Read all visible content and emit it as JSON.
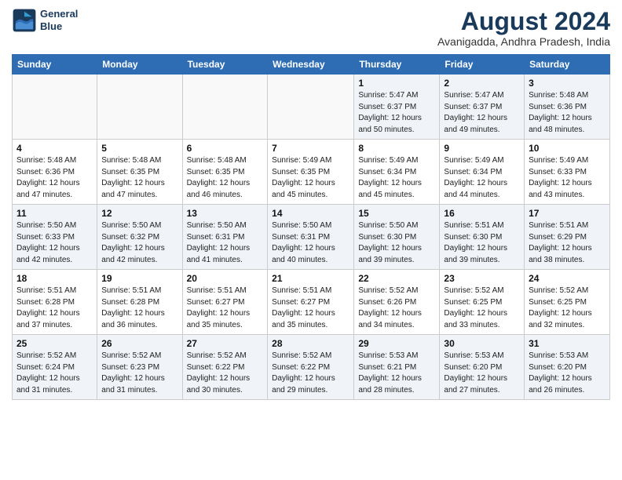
{
  "header": {
    "logo_line1": "General",
    "logo_line2": "Blue",
    "title": "August 2024",
    "subtitle": "Avanigadda, Andhra Pradesh, India"
  },
  "days_of_week": [
    "Sunday",
    "Monday",
    "Tuesday",
    "Wednesday",
    "Thursday",
    "Friday",
    "Saturday"
  ],
  "weeks": [
    [
      {
        "day": "",
        "info": ""
      },
      {
        "day": "",
        "info": ""
      },
      {
        "day": "",
        "info": ""
      },
      {
        "day": "",
        "info": ""
      },
      {
        "day": "1",
        "info": "Sunrise: 5:47 AM\nSunset: 6:37 PM\nDaylight: 12 hours\nand 50 minutes."
      },
      {
        "day": "2",
        "info": "Sunrise: 5:47 AM\nSunset: 6:37 PM\nDaylight: 12 hours\nand 49 minutes."
      },
      {
        "day": "3",
        "info": "Sunrise: 5:48 AM\nSunset: 6:36 PM\nDaylight: 12 hours\nand 48 minutes."
      }
    ],
    [
      {
        "day": "4",
        "info": "Sunrise: 5:48 AM\nSunset: 6:36 PM\nDaylight: 12 hours\nand 47 minutes."
      },
      {
        "day": "5",
        "info": "Sunrise: 5:48 AM\nSunset: 6:35 PM\nDaylight: 12 hours\nand 47 minutes."
      },
      {
        "day": "6",
        "info": "Sunrise: 5:48 AM\nSunset: 6:35 PM\nDaylight: 12 hours\nand 46 minutes."
      },
      {
        "day": "7",
        "info": "Sunrise: 5:49 AM\nSunset: 6:35 PM\nDaylight: 12 hours\nand 45 minutes."
      },
      {
        "day": "8",
        "info": "Sunrise: 5:49 AM\nSunset: 6:34 PM\nDaylight: 12 hours\nand 45 minutes."
      },
      {
        "day": "9",
        "info": "Sunrise: 5:49 AM\nSunset: 6:34 PM\nDaylight: 12 hours\nand 44 minutes."
      },
      {
        "day": "10",
        "info": "Sunrise: 5:49 AM\nSunset: 6:33 PM\nDaylight: 12 hours\nand 43 minutes."
      }
    ],
    [
      {
        "day": "11",
        "info": "Sunrise: 5:50 AM\nSunset: 6:33 PM\nDaylight: 12 hours\nand 42 minutes."
      },
      {
        "day": "12",
        "info": "Sunrise: 5:50 AM\nSunset: 6:32 PM\nDaylight: 12 hours\nand 42 minutes."
      },
      {
        "day": "13",
        "info": "Sunrise: 5:50 AM\nSunset: 6:31 PM\nDaylight: 12 hours\nand 41 minutes."
      },
      {
        "day": "14",
        "info": "Sunrise: 5:50 AM\nSunset: 6:31 PM\nDaylight: 12 hours\nand 40 minutes."
      },
      {
        "day": "15",
        "info": "Sunrise: 5:50 AM\nSunset: 6:30 PM\nDaylight: 12 hours\nand 39 minutes."
      },
      {
        "day": "16",
        "info": "Sunrise: 5:51 AM\nSunset: 6:30 PM\nDaylight: 12 hours\nand 39 minutes."
      },
      {
        "day": "17",
        "info": "Sunrise: 5:51 AM\nSunset: 6:29 PM\nDaylight: 12 hours\nand 38 minutes."
      }
    ],
    [
      {
        "day": "18",
        "info": "Sunrise: 5:51 AM\nSunset: 6:28 PM\nDaylight: 12 hours\nand 37 minutes."
      },
      {
        "day": "19",
        "info": "Sunrise: 5:51 AM\nSunset: 6:28 PM\nDaylight: 12 hours\nand 36 minutes."
      },
      {
        "day": "20",
        "info": "Sunrise: 5:51 AM\nSunset: 6:27 PM\nDaylight: 12 hours\nand 35 minutes."
      },
      {
        "day": "21",
        "info": "Sunrise: 5:51 AM\nSunset: 6:27 PM\nDaylight: 12 hours\nand 35 minutes."
      },
      {
        "day": "22",
        "info": "Sunrise: 5:52 AM\nSunset: 6:26 PM\nDaylight: 12 hours\nand 34 minutes."
      },
      {
        "day": "23",
        "info": "Sunrise: 5:52 AM\nSunset: 6:25 PM\nDaylight: 12 hours\nand 33 minutes."
      },
      {
        "day": "24",
        "info": "Sunrise: 5:52 AM\nSunset: 6:25 PM\nDaylight: 12 hours\nand 32 minutes."
      }
    ],
    [
      {
        "day": "25",
        "info": "Sunrise: 5:52 AM\nSunset: 6:24 PM\nDaylight: 12 hours\nand 31 minutes."
      },
      {
        "day": "26",
        "info": "Sunrise: 5:52 AM\nSunset: 6:23 PM\nDaylight: 12 hours\nand 31 minutes."
      },
      {
        "day": "27",
        "info": "Sunrise: 5:52 AM\nSunset: 6:22 PM\nDaylight: 12 hours\nand 30 minutes."
      },
      {
        "day": "28",
        "info": "Sunrise: 5:52 AM\nSunset: 6:22 PM\nDaylight: 12 hours\nand 29 minutes."
      },
      {
        "day": "29",
        "info": "Sunrise: 5:53 AM\nSunset: 6:21 PM\nDaylight: 12 hours\nand 28 minutes."
      },
      {
        "day": "30",
        "info": "Sunrise: 5:53 AM\nSunset: 6:20 PM\nDaylight: 12 hours\nand 27 minutes."
      },
      {
        "day": "31",
        "info": "Sunrise: 5:53 AM\nSunset: 6:20 PM\nDaylight: 12 hours\nand 26 minutes."
      }
    ]
  ]
}
